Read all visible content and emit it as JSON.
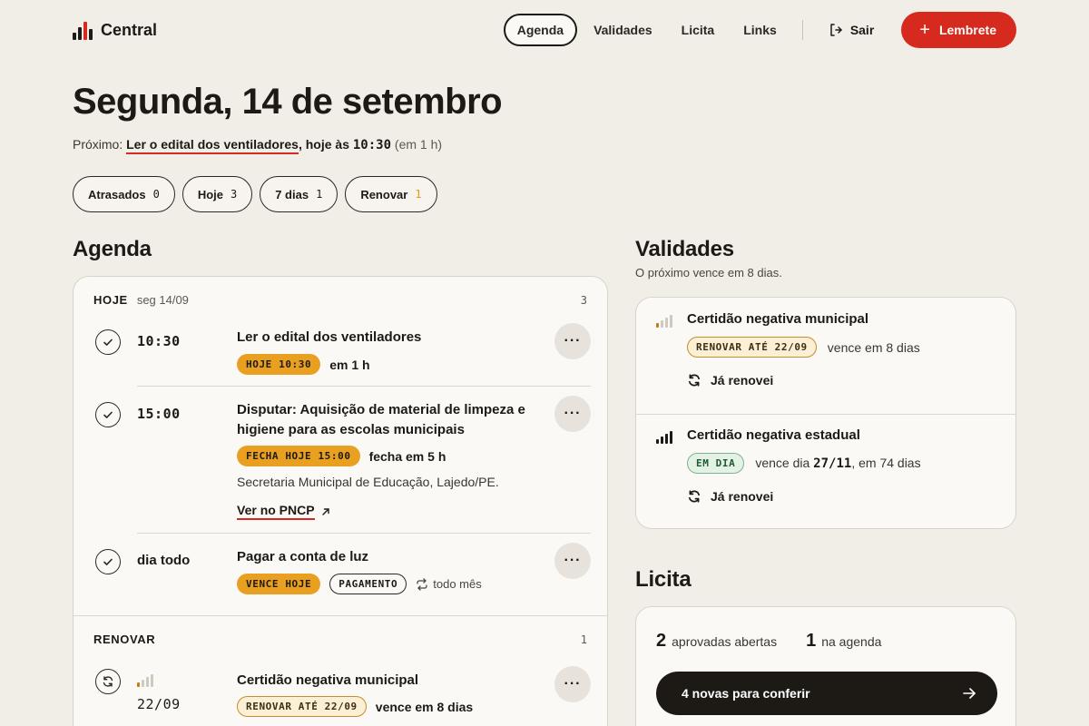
{
  "header": {
    "brand": "Central",
    "nav": [
      "Agenda",
      "Validades",
      "Licita",
      "Links"
    ],
    "active_nav": "Agenda",
    "logout": "Sair",
    "cta": "Lembrete"
  },
  "page": {
    "title": "Segunda, 14 de setembro",
    "next_prefix": "Próximo:",
    "next_title": "Ler o edital dos ventiladores",
    "next_mid": ", hoje às",
    "next_time": "10:30",
    "next_rel": "(em 1 h)"
  },
  "filters": [
    {
      "label": "Atrasados",
      "count": "0"
    },
    {
      "label": "Hoje",
      "count": "3"
    },
    {
      "label": "7 dias",
      "count": "1"
    },
    {
      "label": "Renovar",
      "count": "1"
    }
  ],
  "agenda": {
    "title": "Agenda",
    "today": {
      "label": "HOJE",
      "date": "seg 14/09",
      "count": "3",
      "items": [
        {
          "time": "10:30",
          "title": "Ler o edital dos ventiladores",
          "badge": "HOJE 10:30",
          "rel": "em 1 h"
        },
        {
          "time": "15:00",
          "title": "Disputar: Aquisição de material de limpeza e higiene para as escolas municipais",
          "badge": "FECHA HOJE 15:00",
          "rel": "fecha em 5 h",
          "org": "Secretaria Municipal de Educação, Lajedo/PE.",
          "link": "Ver no PNCP"
        },
        {
          "time": "dia todo",
          "title": "Pagar a conta de luz",
          "badge": "VENCE HOJE",
          "badge2": "PAGAMENTO",
          "recur": "todo mês"
        }
      ]
    },
    "renew": {
      "label": "RENOVAR",
      "count": "1",
      "items": [
        {
          "date": "22/09",
          "title": "Certidão negativa municipal",
          "badge": "RENOVAR ATÉ 22/09",
          "rel": "vence em 8 dias"
        }
      ]
    },
    "more": "···"
  },
  "validades": {
    "title": "Validades",
    "note": "O próximo vence em 8 dias.",
    "items": [
      {
        "title": "Certidão negativa municipal",
        "badge": "RENOVAR ATÉ 22/09",
        "text": "vence em 8 dias",
        "action": "Já renovei",
        "level": 1
      },
      {
        "title": "Certidão negativa estadual",
        "badge": "EM DIA",
        "text_pre": "vence dia",
        "date": "27/11",
        "text_post": ", em 74 dias",
        "action": "Já renovei",
        "level": 4
      }
    ]
  },
  "licita": {
    "title": "Licita",
    "open_count": "2",
    "open_label": "aprovadas abertas",
    "agenda_count": "1",
    "agenda_label": "na agenda",
    "cta": "4 novas para conferir"
  },
  "colors": {
    "accent": "#d62a1e",
    "warning": "#e9a021",
    "ok": "#1f5a33"
  }
}
